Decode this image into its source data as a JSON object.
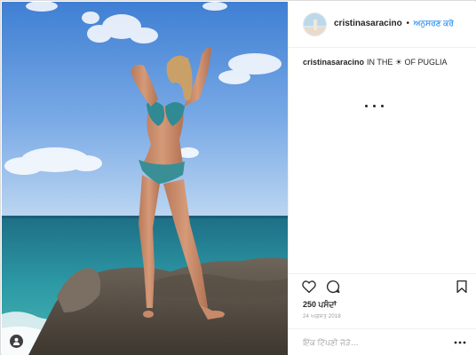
{
  "header": {
    "username": "cristinasaracino",
    "separator": "•",
    "follow_label": "ਅਨੁਸਰਣ ਕਰੋ"
  },
  "caption": {
    "username": "cristinasaracino",
    "text": "IN THE ☀ OF PUGLIA"
  },
  "likes": "250 ਪਸੰਦਾਂ",
  "date": "24 ਅਗਸਤ 2018",
  "comment": {
    "placeholder": "ਇੱਕ ਟਿੱਪਣੀ ਜੋੜੋ…"
  },
  "icons": {
    "like": "heart-icon",
    "comment": "comment-icon",
    "save": "bookmark-icon",
    "more": "more-options-icon",
    "tag": "user-tag-icon"
  },
  "colors": {
    "follow": "#3897f0",
    "text": "#262626",
    "muted": "#999999"
  }
}
